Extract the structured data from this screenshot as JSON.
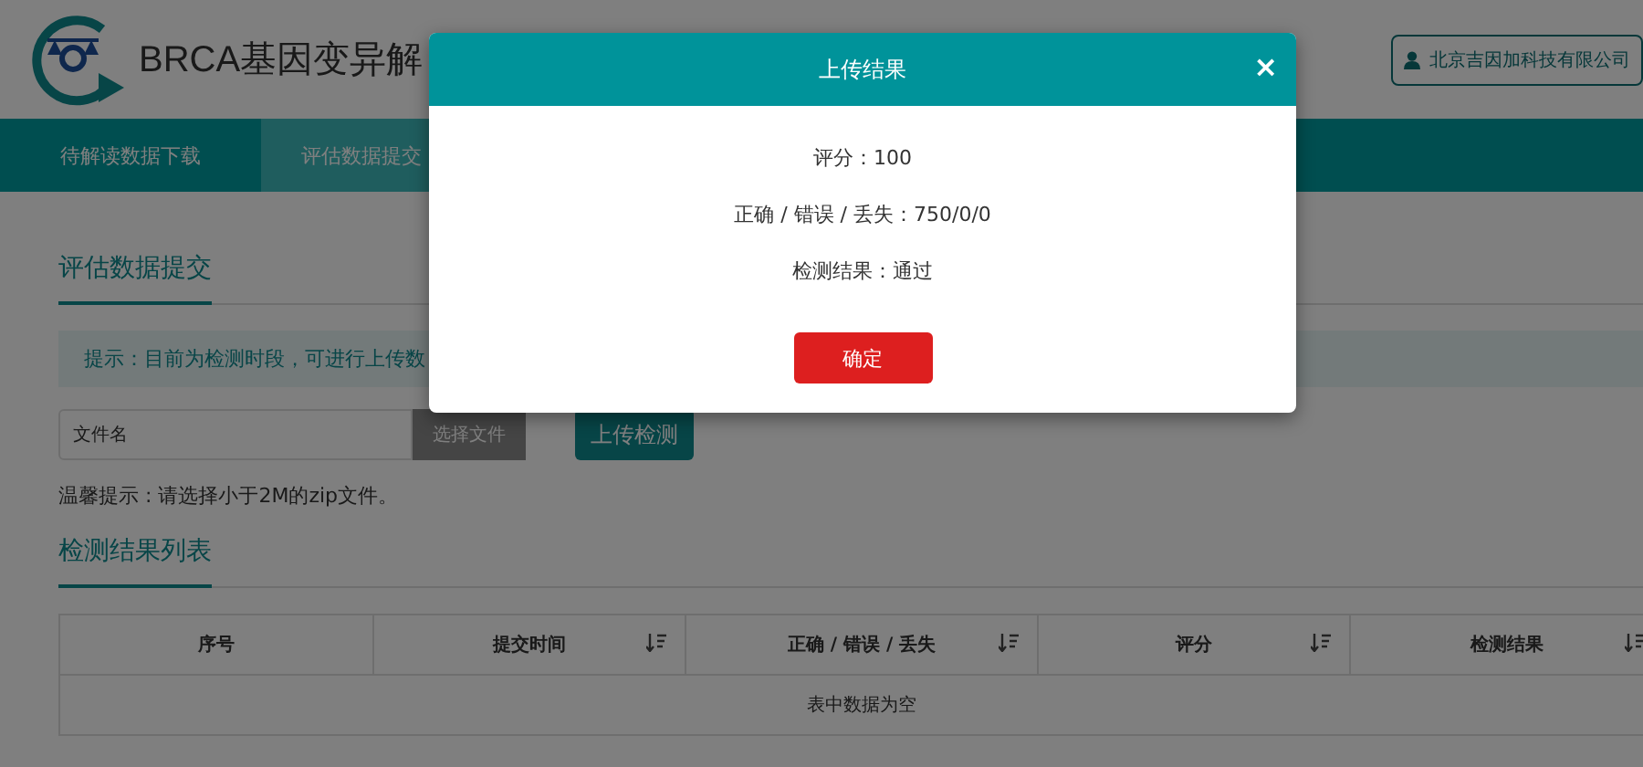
{
  "header": {
    "title": "BRCA基因变异解",
    "user": "北京吉因加科技有限公司"
  },
  "nav": [
    {
      "label": "待解读数据下载",
      "selected": false
    },
    {
      "label": "评估数据提交",
      "selected": true
    }
  ],
  "section_title": "评估数据提交",
  "notice": "提示：目前为检测时段，可进行上传数",
  "upload": {
    "placeholder": "文件名",
    "choose_button": "选择文件",
    "upload_button": "上传检测"
  },
  "hint": "温馨提示 : 请选择小于2M的zip文件。",
  "list_title": "检测结果列表",
  "table": {
    "columns": [
      {
        "label": "序号",
        "sortable": false
      },
      {
        "label": "提交时间",
        "sortable": true
      },
      {
        "label": "正确 / 错误 / 丢失",
        "sortable": true
      },
      {
        "label": "评分",
        "sortable": true
      },
      {
        "label": "检测结果",
        "sortable": true
      }
    ],
    "empty": "表中数据为空"
  },
  "dialog": {
    "title": "上传结果",
    "close": "×",
    "lines": [
      "评分：100",
      "正确 / 错误 / 丢失：750/0/0",
      "检测结果：通过"
    ],
    "ok": "确定"
  }
}
